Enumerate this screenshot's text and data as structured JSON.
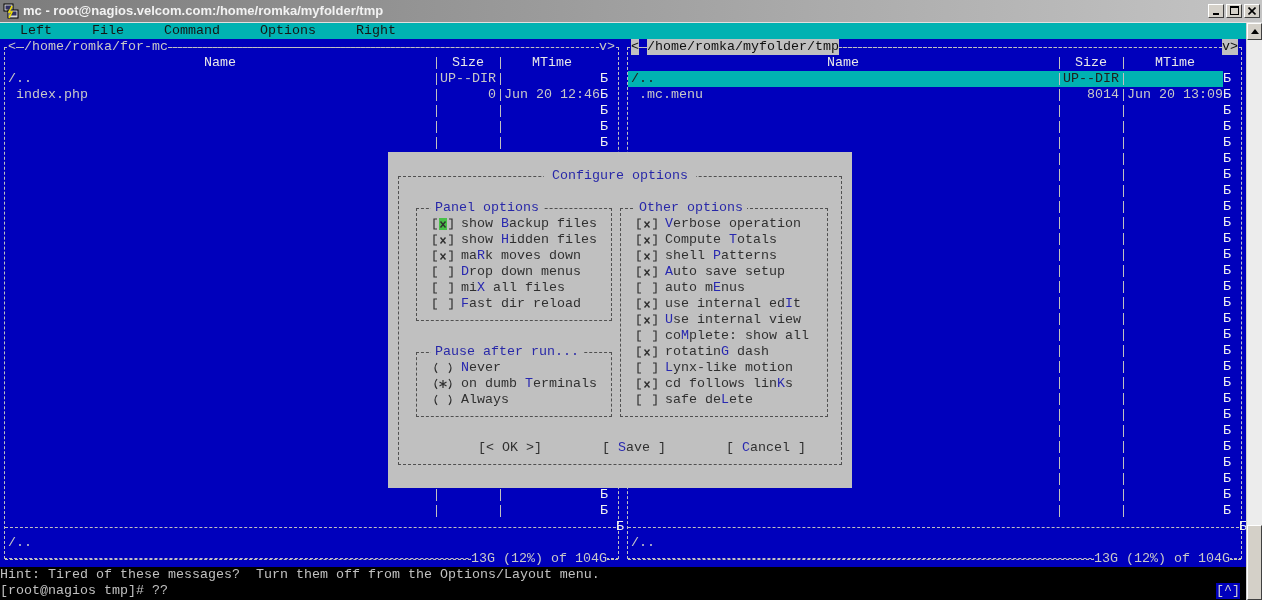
{
  "window": {
    "title": "mc - root@nagios.velcom.com:/home/romka/myfolder/tmp"
  },
  "menu": [
    {
      "label": "Left"
    },
    {
      "label": "File"
    },
    {
      "label": "Command"
    },
    {
      "label": "Options"
    },
    {
      "label": "Right"
    }
  ],
  "panels": [
    {
      "path": "/home/romka/for-mc",
      "active": false,
      "left_arrow": "<",
      "right_arrow": "v>",
      "columns": [
        "Name",
        "Size",
        "MTime"
      ],
      "rows": [
        {
          "kind": "updir",
          "name": "/..",
          "size": "UP--DIR",
          "mark": "Б",
          "selected": false
        },
        {
          "kind": "file",
          "name": "index.php",
          "size": "0",
          "mtime": "Jun 20 12:46",
          "mark": "Б",
          "selected": false
        },
        {
          "kind": "empty",
          "mark": "Б",
          "selected": false
        },
        {
          "kind": "empty",
          "mark": "Б",
          "selected": false
        },
        {
          "kind": "empty",
          "mark": "Б",
          "selected": false
        },
        {
          "kind": "covered"
        },
        {
          "kind": "covered"
        },
        {
          "kind": "covered"
        },
        {
          "kind": "covered"
        },
        {
          "kind": "covered"
        },
        {
          "kind": "covered"
        },
        {
          "kind": "covered"
        },
        {
          "kind": "covered"
        },
        {
          "kind": "covered"
        },
        {
          "kind": "covered"
        },
        {
          "kind": "covered"
        },
        {
          "kind": "covered"
        },
        {
          "kind": "covered"
        },
        {
          "kind": "covered"
        },
        {
          "kind": "covered"
        },
        {
          "kind": "covered"
        },
        {
          "kind": "covered"
        },
        {
          "kind": "covered"
        },
        {
          "kind": "covered"
        },
        {
          "kind": "covered"
        },
        {
          "kind": "covered"
        },
        {
          "kind": "empty",
          "mark": "Б",
          "selected": false
        },
        {
          "kind": "empty",
          "mark": "Б",
          "selected": false
        }
      ],
      "separator_mark": "Б",
      "mini_status": "/..",
      "free_space": "13G (12%) of 104G"
    },
    {
      "path": "/home/romka/myfolder/tmp",
      "active": true,
      "left_arrow": "<",
      "right_arrow": "v>",
      "columns": [
        "Name",
        "Size",
        "MTime"
      ],
      "rows": [
        {
          "kind": "updir",
          "name": "/..",
          "size": "UP--DIR",
          "mark": "Б",
          "selected": true
        },
        {
          "kind": "file",
          "name": ".mc.menu",
          "size": "8014",
          "mtime": "Jun 20 13:09",
          "mark": "Б",
          "selected": false
        },
        {
          "kind": "empty",
          "mark": "Б",
          "selected": false
        },
        {
          "kind": "empty",
          "mark": "Б",
          "selected": false
        },
        {
          "kind": "empty",
          "mark": "Б",
          "selected": false
        },
        {
          "kind": "empty",
          "mark": "Б",
          "selected": false
        },
        {
          "kind": "empty",
          "mark": "Б",
          "selected": false
        },
        {
          "kind": "empty",
          "mark": "Б",
          "selected": false
        },
        {
          "kind": "empty",
          "mark": "Б",
          "selected": false
        },
        {
          "kind": "empty",
          "mark": "Б",
          "selected": false
        },
        {
          "kind": "empty",
          "mark": "Б",
          "selected": false
        },
        {
          "kind": "empty",
          "mark": "Б",
          "selected": false
        },
        {
          "kind": "empty",
          "mark": "Б",
          "selected": false
        },
        {
          "kind": "empty",
          "mark": "Б",
          "selected": false
        },
        {
          "kind": "empty",
          "mark": "Б",
          "selected": false
        },
        {
          "kind": "empty",
          "mark": "Б",
          "selected": false
        },
        {
          "kind": "empty",
          "mark": "Б",
          "selected": false
        },
        {
          "kind": "empty",
          "mark": "Б",
          "selected": false
        },
        {
          "kind": "empty",
          "mark": "Б",
          "selected": false
        },
        {
          "kind": "empty",
          "mark": "Б",
          "selected": false
        },
        {
          "kind": "empty",
          "mark": "Б",
          "selected": false
        },
        {
          "kind": "empty",
          "mark": "Б",
          "selected": false
        },
        {
          "kind": "empty",
          "mark": "Б",
          "selected": false
        },
        {
          "kind": "empty",
          "mark": "Б",
          "selected": false
        },
        {
          "kind": "empty",
          "mark": "Б",
          "selected": false
        },
        {
          "kind": "empty",
          "mark": "Б",
          "selected": false
        },
        {
          "kind": "empty",
          "mark": "Б",
          "selected": false
        },
        {
          "kind": "empty",
          "mark": "Б",
          "selected": false
        }
      ],
      "separator_mark": "Б",
      "mini_status": "/..",
      "free_space": "13G (12%) of 104G"
    }
  ],
  "dialog": {
    "title": "Configure options",
    "panel_options": {
      "title": "Panel options",
      "items": [
        {
          "label": "show **B**ackup files",
          "checked": true,
          "focused": true
        },
        {
          "label": "show **H**idden files",
          "checked": true,
          "focused": false
        },
        {
          "label": "ma**R**k moves down",
          "checked": true,
          "focused": false
        },
        {
          "label": "**D**rop down menus",
          "checked": false,
          "focused": false
        },
        {
          "label": "mi**X** all files",
          "checked": false,
          "focused": false
        },
        {
          "label": "**F**ast dir reload",
          "checked": false,
          "focused": false
        }
      ]
    },
    "pause_after_run": {
      "title": "Pause after run...",
      "items": [
        {
          "label": "**N**ever",
          "selected": false
        },
        {
          "label": "on dumb **T**erminals",
          "selected": true
        },
        {
          "label": "Always",
          "selected": false
        }
      ]
    },
    "other_options": {
      "title": "Other options",
      "items": [
        {
          "label": "**V**erbose operation",
          "checked": true
        },
        {
          "label": "Compute **T**otals",
          "checked": true
        },
        {
          "label": "shell **P**atterns",
          "checked": true
        },
        {
          "label": "**A**uto save setup",
          "checked": true
        },
        {
          "label": "auto m**E**nus",
          "checked": false
        },
        {
          "label": "use internal ed**I**t",
          "checked": true
        },
        {
          "label": "**U**se internal view",
          "checked": true
        },
        {
          "label": "co**M**plete: show all",
          "checked": false
        },
        {
          "label": "rotatin**G** dash",
          "checked": true
        },
        {
          "label": "**L**ynx-like motion",
          "checked": false
        },
        {
          "label": "cd follows lin**K**s",
          "checked": true
        },
        {
          "label": "safe de**L**ete",
          "checked": false
        }
      ]
    },
    "buttons": [
      {
        "label": "[< OK >]"
      },
      {
        "label": "[ **S**ave ]"
      },
      {
        "label": "[ **C**ancel ]"
      }
    ]
  },
  "hint": "Hint: Tired of these messages?  Turn them off from the Options/Layout menu.",
  "prompt": "[root@nagios tmp]# ??",
  "corner": "[^]"
}
